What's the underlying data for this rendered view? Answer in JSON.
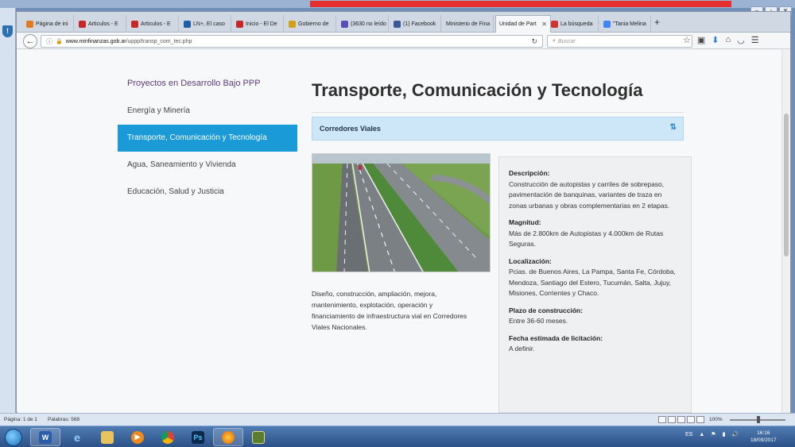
{
  "browser": {
    "tabs": [
      {
        "label": "Página de ini",
        "color": "#e07b23"
      },
      {
        "label": "Articulos - E",
        "color": "#c62828"
      },
      {
        "label": "Articulos - E",
        "color": "#c62828"
      },
      {
        "label": "LN+, El caso",
        "color": "#1f5fa8"
      },
      {
        "label": "Inicio - El De",
        "color": "#c62828"
      },
      {
        "label": "Gobierno de",
        "color": "#d4a017"
      },
      {
        "label": "(3630 no leído",
        "color": "#5b4bb7"
      },
      {
        "label": "(1) Facebook",
        "color": "#3b5998"
      },
      {
        "label": "Ministerio de Fina",
        "color": "#ffffff"
      },
      {
        "label": "Unidad de Part",
        "color": "#ffffff"
      },
      {
        "label": "La búsqueda",
        "color": "#d32f2f"
      },
      {
        "label": "\"Tania Melina",
        "color": "#4285f4"
      }
    ],
    "active_tab_index": 9,
    "url_host": "www.minfinanzas.gob.ar",
    "url_path": "/uppp/transp_com_tec.php",
    "search_placeholder": "Buscar"
  },
  "sidebar": {
    "heading": "Proyectos en Desarrollo Bajo PPP",
    "items": [
      {
        "label": "Energía y Minería"
      },
      {
        "label": "Transporte, Comunicación y Tecnología"
      },
      {
        "label": "Agua, Saneamiento y Vivienda"
      },
      {
        "label": "Educación, Salud y Justicia"
      }
    ],
    "active_index": 1
  },
  "main": {
    "title": "Transporte, Comunicación y Tecnología",
    "accordion_label": "Corredores Viales",
    "description": "Diseño, construcción, ampliación, mejora, mantenimiento, explotación, operación y financiamiento de infraestructura vial en Corredores Viales Nacionales.",
    "details": [
      {
        "label": "Descripción:",
        "value": "Construcción de autopistas y carriles de sobrepaso, pavimentación de banquinas, variantes de traza en zonas urbanas y obras complementarias en 2 etapas."
      },
      {
        "label": "Magnitud:",
        "value": "Más de 2.800km de Autopistas y 4.000km de Rutas Seguras."
      },
      {
        "label": "Localización:",
        "value": "Pcias. de Buenos Aires, La Pampa, Santa Fe, Córdoba, Mendoza, Santiago del Estero, Tucumán, Salta, Jujuy, Misiones, Corrientes y Chaco."
      },
      {
        "label": "Plazo de construcción:",
        "value": "Entre 36-60 meses."
      },
      {
        "label": "Fecha estimada de licitación:",
        "value": "A definir."
      }
    ]
  },
  "word_status": {
    "page": "Página: 1 de 1",
    "words": "Palabras: 568",
    "zoom": "100%"
  },
  "taskbar": {
    "apps": [
      "word-app",
      "ie-app",
      "explorer-app",
      "media-app",
      "chrome-app",
      "photoshop-app",
      "firefox-app",
      "game-app"
    ],
    "language": "ES",
    "time": "16:16",
    "date": "18/09/2017"
  }
}
